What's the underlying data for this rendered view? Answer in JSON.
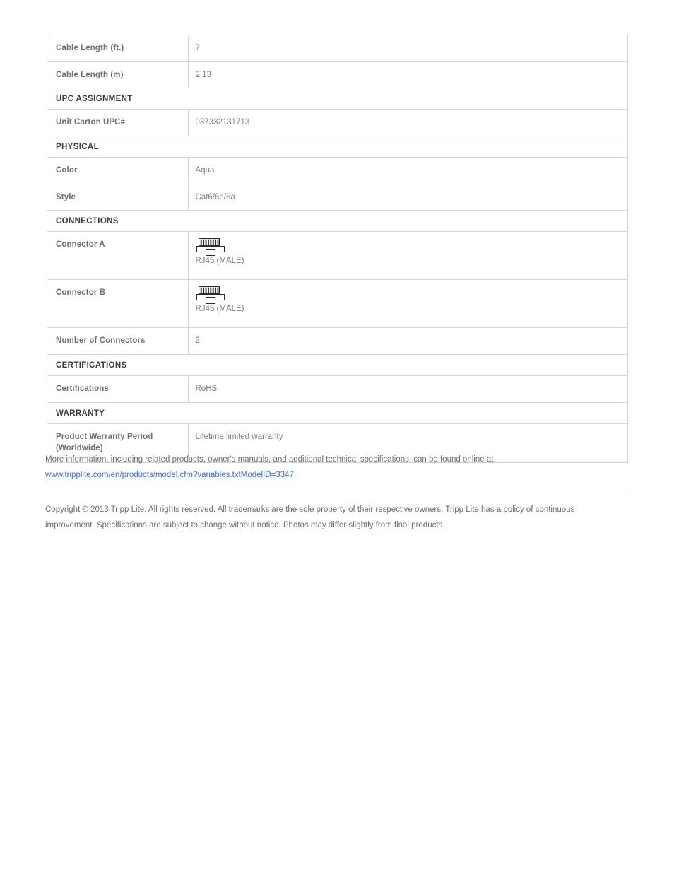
{
  "spec_table": {
    "rows": [
      {
        "kind": "data",
        "label": "Cable Length (ft.)",
        "value": "7"
      },
      {
        "kind": "data",
        "label": "Cable Length (m)",
        "value": "2.13"
      },
      {
        "kind": "section",
        "label": "UPC ASSIGNMENT"
      },
      {
        "kind": "data",
        "label": "Unit Carton UPC#",
        "value": "037332131713"
      },
      {
        "kind": "section",
        "label": "PHYSICAL"
      },
      {
        "kind": "data",
        "label": "Color",
        "value": "Aqua"
      },
      {
        "kind": "data",
        "label": "Style",
        "value": "Cat6/6e/6a"
      },
      {
        "kind": "section",
        "label": "CONNECTIONS"
      },
      {
        "kind": "connector",
        "label": "Connector A",
        "value": "RJ45 (MALE)",
        "icon": "rj45-connector-icon"
      },
      {
        "kind": "connector",
        "label": "Connector B",
        "value": "RJ45 (MALE)",
        "icon": "rj45-connector-icon"
      },
      {
        "kind": "data",
        "label": "Number of Connectors",
        "value": "2"
      },
      {
        "kind": "section",
        "label": "CERTIFICATIONS"
      },
      {
        "kind": "data",
        "label": "Certifications",
        "value": "RoHS"
      },
      {
        "kind": "section",
        "label": "WARRANTY"
      },
      {
        "kind": "data",
        "label": "Product Warranty Period (Worldwide)",
        "label_line1": "Product Warranty Period",
        "label_line2": "(Worldwide)",
        "value": "Lifetime limited warranty"
      }
    ]
  },
  "more_info": {
    "text_before": "More information, including related products, owner's manuals, and additional technical specifications, can be found online at",
    "link_text": "www.tripplite.com/en/products/model.cfm?variables.txtModelID=3347",
    "text_after": "."
  },
  "copyright": {
    "text": "Copyright © 2013 Tripp Lite. All rights reserved. All trademarks are the sole property of their respective owners. Tripp Lite has a policy of continuous improvement. Specifications are subject to change without notice. Photos may differ slightly from final products."
  },
  "colors": {
    "link": "#3a6fd8",
    "label_text": "#6e6e6e",
    "value_text": "#7d7d7d",
    "section_text": "#3b3b3b",
    "border": "#d5d5d5"
  }
}
